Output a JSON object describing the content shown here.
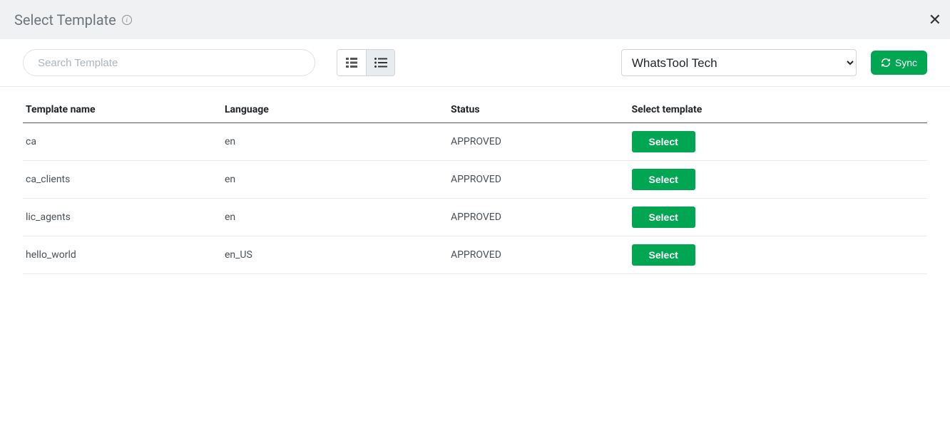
{
  "header": {
    "title": "Select Template",
    "close_label": "✕"
  },
  "toolbar": {
    "search_placeholder": "Search Template",
    "dropdown_selected": "WhatsTool Tech",
    "sync_label": "Sync"
  },
  "table": {
    "columns": [
      "Template name",
      "Language",
      "Status",
      "Select template"
    ],
    "rows": [
      {
        "name": "ca",
        "language": "en",
        "status": "APPROVED",
        "action": "Select"
      },
      {
        "name": "ca_clients",
        "language": "en",
        "status": "APPROVED",
        "action": "Select"
      },
      {
        "name": "lic_agents",
        "language": "en",
        "status": "APPROVED",
        "action": "Select"
      },
      {
        "name": "hello_world",
        "language": "en_US",
        "status": "APPROVED",
        "action": "Select"
      }
    ]
  }
}
